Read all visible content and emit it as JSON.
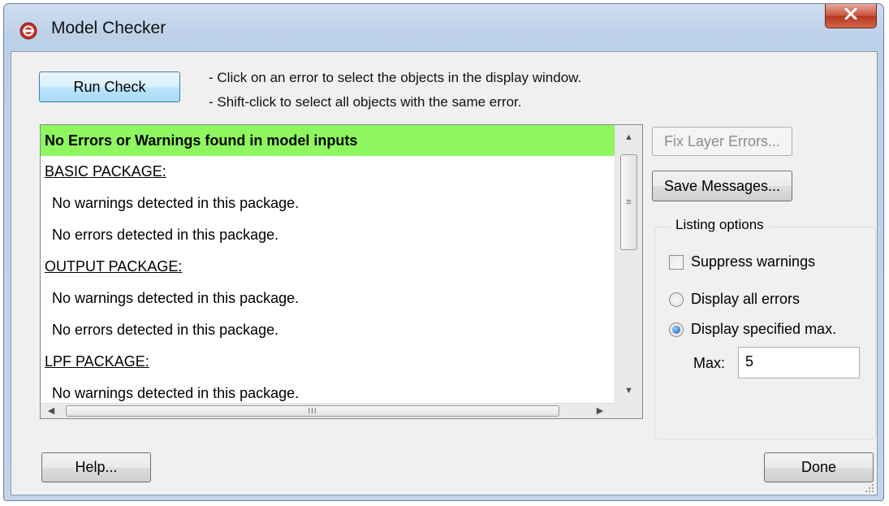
{
  "window": {
    "title": "Model Checker",
    "close_glyph": "X",
    "icon": "app-logo-icon"
  },
  "toolbar": {
    "run_check_label": "Run Check",
    "hint_line_1": "- Click on an error to select the objects in the display window.",
    "hint_line_2": "- Shift-click to select all objects with the same error."
  },
  "messages": {
    "rows": [
      {
        "text": "No Errors or Warnings found in model inputs",
        "kind": "ok"
      },
      {
        "text": "BASIC PACKAGE:",
        "kind": "header"
      },
      {
        "text": "No warnings detected in this package.",
        "kind": "msg"
      },
      {
        "text": "No errors detected in this package.",
        "kind": "msg"
      },
      {
        "text": "OUTPUT PACKAGE:",
        "kind": "header"
      },
      {
        "text": "No warnings detected in this package.",
        "kind": "msg"
      },
      {
        "text": "No errors detected in this package.",
        "kind": "msg"
      },
      {
        "text": "LPF PACKAGE:",
        "kind": "header"
      },
      {
        "text": "No warnings detected in this package.",
        "kind": "msg"
      }
    ],
    "ok_color": "#8ef760"
  },
  "side": {
    "fix_layer_errors_label": "Fix Layer Errors...",
    "save_messages_label": "Save Messages...",
    "listing_options_title": "Listing options",
    "suppress_warnings_label": "Suppress warnings",
    "suppress_warnings_checked": false,
    "display_all_errors_label": "Display all errors",
    "display_specified_max_label": "Display specified max.",
    "selected_mode": "display_specified_max",
    "max_label": "Max:",
    "max_value": "5"
  },
  "footer": {
    "help_label": "Help...",
    "done_label": "Done"
  }
}
